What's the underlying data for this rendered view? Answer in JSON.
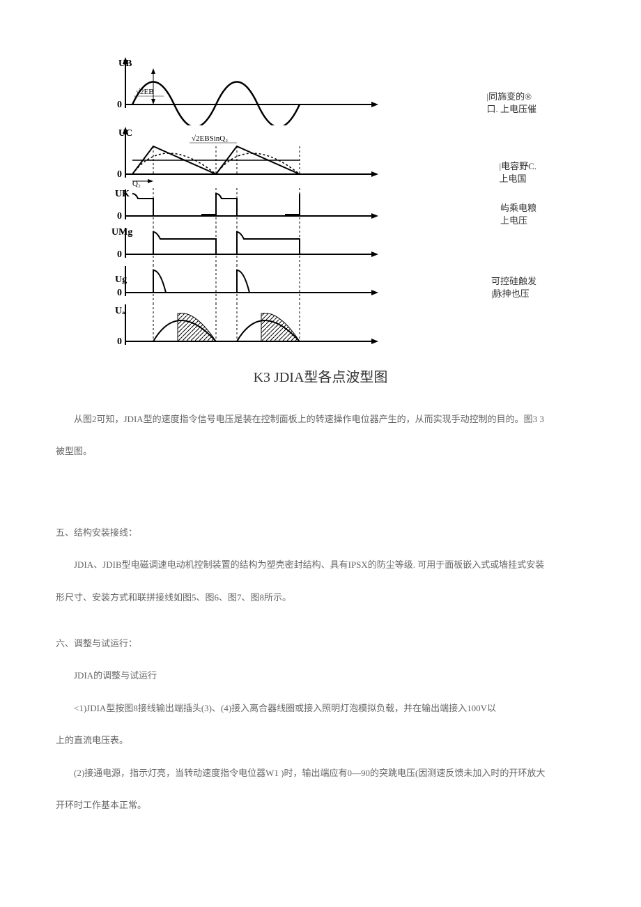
{
  "waveforms": {
    "ub": {
      "axis_label": "UB",
      "formula": "√2EB"
    },
    "uc": {
      "axis_label": "UC",
      "q_label": "Q₂",
      "formula": "√2EBSinQ₂"
    },
    "uk": {
      "axis_label": "UK"
    },
    "um": {
      "axis_label": "UMg"
    },
    "ug": {
      "axis_label": "Ug"
    },
    "ua": {
      "axis_label": "Uₐ"
    }
  },
  "right_labels": {
    "r1a": "|同旆变的®",
    "r1b": "口. 上电压催",
    "r2a": "|电容野C.",
    "r2b": "上电国",
    "r3a": "屿乘电粮",
    "r3b": "上电压",
    "r4a": "可控硅触发",
    "r4b": "|脉抻也压"
  },
  "diagram_title": "K3 JDIA型各点波型图",
  "body": {
    "p1": "从图2可知，JDIA型的速度指令信号电压是装在控制面板上的转速操作电位器产生的，从而实现手动控制的目的。图3 3",
    "p1b": "被型图。",
    "h5": "五、结构安装接线：",
    "p2": "JDIA、JDIB型电磁调速电动机控制装置的结构为塑壳密封结构、具有IPSX的防尘等级. 可用于面板嵌入式或墙挂式安装",
    "p2b": "形尺寸、安装方式和联拼接线如图5、图6、图7、图8所示。",
    "h6": "六、调整与试运行：",
    "p3": "JDIA的调整与试运行",
    "p4": "<1)JDIA型按图8接线输出端插头(3)、(4)接入离合器线圈或接入照明灯泡模拟负载，并在输出端接入100V以",
    "p4b": "上的直流电压表。",
    "p5": "(2)接通电源，指示灯亮，当转动速度指令电位器W1 )时，输出端应有0—90的突跳电压(因测速反馈未加入时的开环放大",
    "p5b": "开环时工作基本正常。"
  }
}
